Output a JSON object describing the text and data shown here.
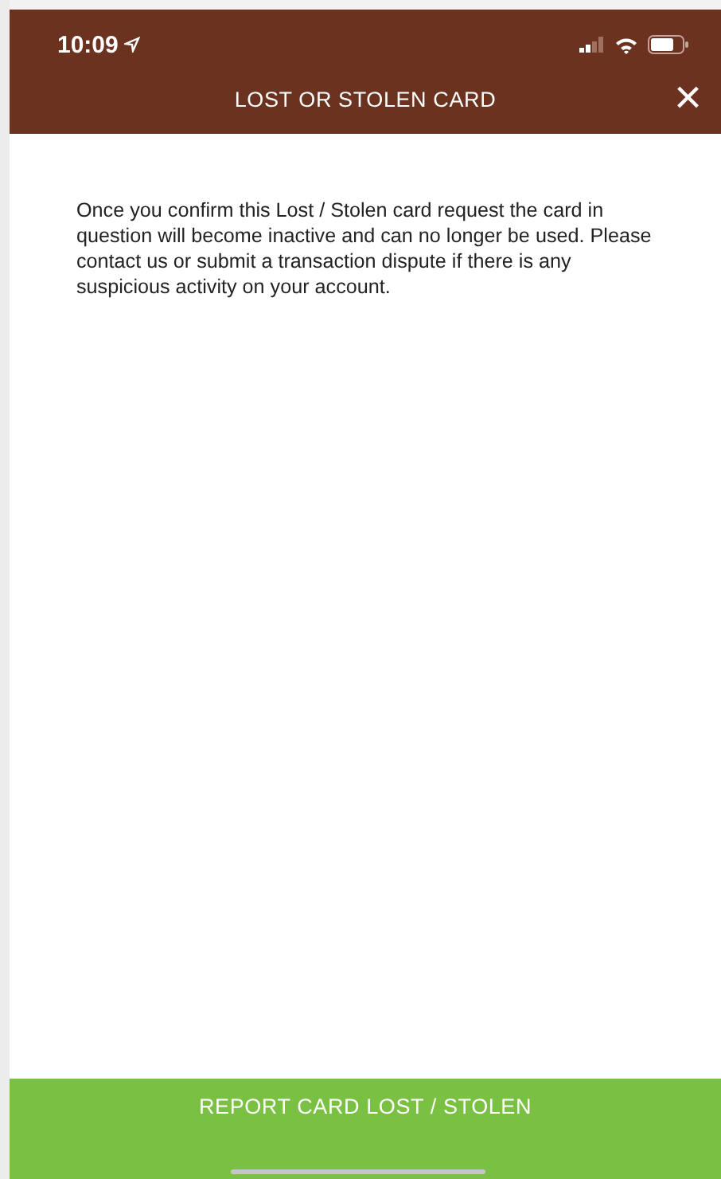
{
  "status_bar": {
    "time": "10:09"
  },
  "header": {
    "title": "LOST OR STOLEN CARD",
    "close": "×"
  },
  "message": "Once you confirm this Lost / Stolen card request the card in question will become inactive and can no longer be used. Please contact us or submit a transaction dispute if there is any suspicious activity on your account.",
  "buttons": [
    "REPORT CARD LOST / STOLEN"
  ]
}
